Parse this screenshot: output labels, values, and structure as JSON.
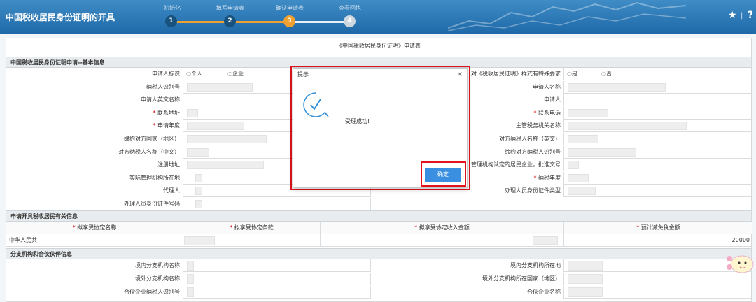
{
  "header": {
    "title": "中国税收居民身份证明的开具",
    "steps": [
      {
        "num": "1",
        "label": "初始化"
      },
      {
        "num": "2",
        "label": "填写申请表"
      },
      {
        "num": "3",
        "label": "确认申请表"
      },
      {
        "num": "4",
        "label": "查看回执"
      }
    ],
    "current_step": 3,
    "icons": [
      "star-icon",
      "help-icon"
    ]
  },
  "form": {
    "title": "《中国税收居民身份证明》申请表",
    "section1": "中国税收居民身份证明申请--基本信息",
    "left_labels": [
      "申请人标识",
      "纳税人识别号",
      "申请人英文名称",
      "联系地址",
      "申请年度",
      "缔约对方国家（地区）",
      "对方纳税人名称（中文）",
      "注册地址",
      "实际管理机构所在地",
      "代理人",
      "办理人员身份证件号码"
    ],
    "right_labels": [
      "对《税收居民证明》样式有特殊要求",
      "申请人名称",
      "申请人",
      "联系电话",
      "主管税务机关名称",
      "对方纳税人名称（英文）",
      "缔约对方纳税人识别号",
      "管理机构认定的居民企业。批准文号",
      "纳税年度",
      "办理人员身份证件类型"
    ],
    "applicant_type_options": [
      "个人",
      "企业"
    ],
    "special_req_options": [
      "是",
      "否"
    ],
    "section2": "申请开具税收居民有关信息",
    "section2_headers": [
      "拟享受协定名称",
      "拟享受协定条款",
      "拟享受协定收入金额",
      "预计减免税金额"
    ],
    "section2_row": {
      "agreement_name": "中华人民共",
      "amount": "20000"
    },
    "section3": "分支机构和合伙伙伴信息",
    "section3_left": [
      "境内分支机构名称",
      "境外分支机构名称",
      "合伙企业纳税人识别号"
    ],
    "section3_right": [
      "境内分支机构所在地",
      "境外分支机构所在国家（地区）",
      "合伙企业名称"
    ]
  },
  "modal": {
    "title": "提示",
    "close": "×",
    "message": "受理成功!",
    "ok_label": "确定"
  },
  "colors": {
    "header": "#1f69a8",
    "accent": "#f0a030",
    "button": "#3b8fe0",
    "highlight": "#e1141e"
  }
}
